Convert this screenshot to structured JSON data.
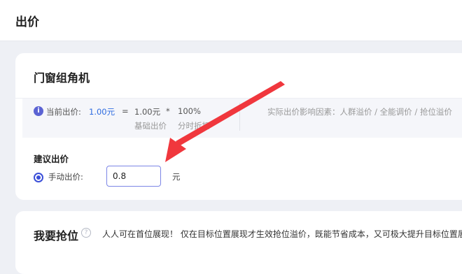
{
  "header": {
    "title": "出价"
  },
  "card": {
    "title": "门窗组角机",
    "bid_formula": {
      "label": "当前出价:",
      "value": "1.00元",
      "equals": "=",
      "base_value": "1.00元",
      "times": "*",
      "percent": "100%",
      "base_label": "基础出价",
      "time_label": "分时折扣"
    },
    "factors_text": "实际出价影响因素：人群溢价 / 全能调价 / 抢位溢价",
    "suggest_title": "建议出价",
    "manual_label": "手动出价:",
    "manual_value": "0.8",
    "unit": "元"
  },
  "grab": {
    "title": "我要抢位",
    "help": "?",
    "description": "人人可在首位展现！ 仅在目标位置展现才生效抢位溢价，既能节省成本，又可极大提升目标位置展"
  },
  "colors": {
    "accent": "#3b4fd8",
    "link": "#2d6be0",
    "annotation_arrow": "#f0373d"
  }
}
